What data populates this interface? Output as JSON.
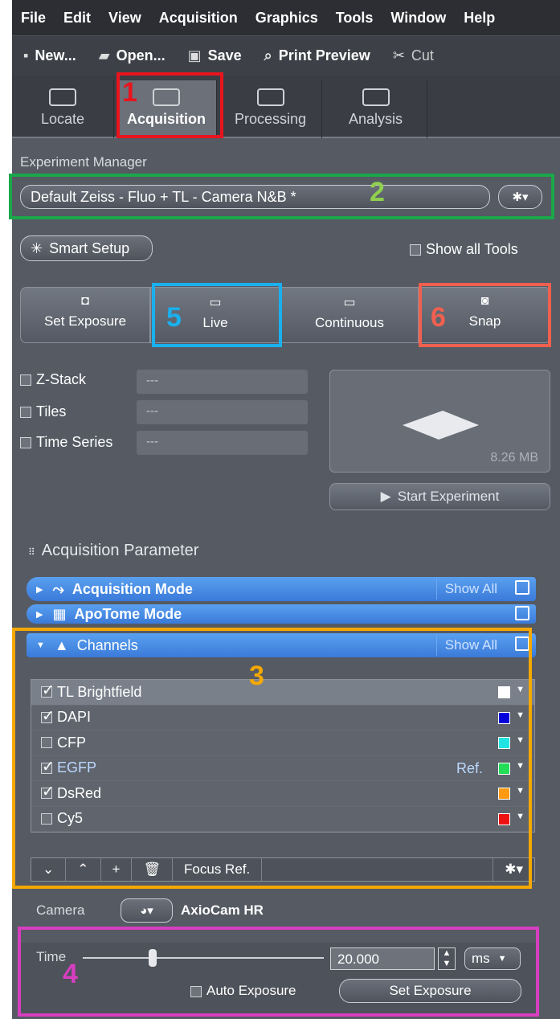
{
  "menu": [
    "File",
    "Edit",
    "View",
    "Acquisition",
    "Graphics",
    "Tools",
    "Window",
    "Help"
  ],
  "toolbar": {
    "new": "New...",
    "open": "Open...",
    "save": "Save",
    "print_preview": "Print Preview",
    "cut": "Cut"
  },
  "tabs": [
    "Locate",
    "Acquisition",
    "Processing",
    "Analysis"
  ],
  "experiment_manager": {
    "label": "Experiment Manager",
    "value": "Default Zeiss - Fluo + TL - Camera N&B *"
  },
  "smart_setup": "Smart Setup",
  "show_all_tools": "Show all Tools",
  "actions": {
    "set_exposure": "Set Exposure",
    "live": "Live",
    "continuous": "Continuous",
    "snap": "Snap"
  },
  "options": [
    {
      "label": "Z-Stack",
      "value": "---"
    },
    {
      "label": "Tiles",
      "value": "---"
    },
    {
      "label": "Time Series",
      "value": "---"
    }
  ],
  "preview_size": "8.26 MB",
  "start_experiment": "Start Experiment",
  "acq_param_title": "Acquisition Parameter",
  "panels": {
    "acq_mode": "Acquisition Mode",
    "apotome": "ApoTome Mode",
    "channels": "Channels",
    "show_all": "Show All"
  },
  "channels": [
    {
      "name": "TL Brightfield",
      "checked": true,
      "color": "#ffffff",
      "ref": ""
    },
    {
      "name": "DAPI",
      "checked": true,
      "color": "#0000dd",
      "ref": ""
    },
    {
      "name": "CFP",
      "checked": false,
      "color": "#22e3e3",
      "ref": ""
    },
    {
      "name": "EGFP",
      "checked": true,
      "color": "#22dd55",
      "ref": "Ref."
    },
    {
      "name": "DsRed",
      "checked": true,
      "color": "#ff9a10",
      "ref": ""
    },
    {
      "name": "Cy5",
      "checked": false,
      "color": "#ee1111",
      "ref": ""
    }
  ],
  "focus_ref": "Focus Ref.",
  "camera": {
    "label": "Camera",
    "name": "AxioCam HR"
  },
  "time": {
    "label": "Time",
    "value": "20.000",
    "unit": "ms",
    "slider_fraction": 0.25
  },
  "auto_exposure": "Auto Exposure",
  "set_exposure_btn": "Set Exposure",
  "annotations": [
    "1",
    "2",
    "3",
    "4",
    "5",
    "6"
  ],
  "colors": {
    "anno1": "#e8141e",
    "anno2": "#1aa84a",
    "anno3": "#f5a800",
    "anno4": "#d63ec0",
    "anno5": "#1ab0ee",
    "anno6": "#f0604f",
    "accent": "#3a7ad9"
  }
}
